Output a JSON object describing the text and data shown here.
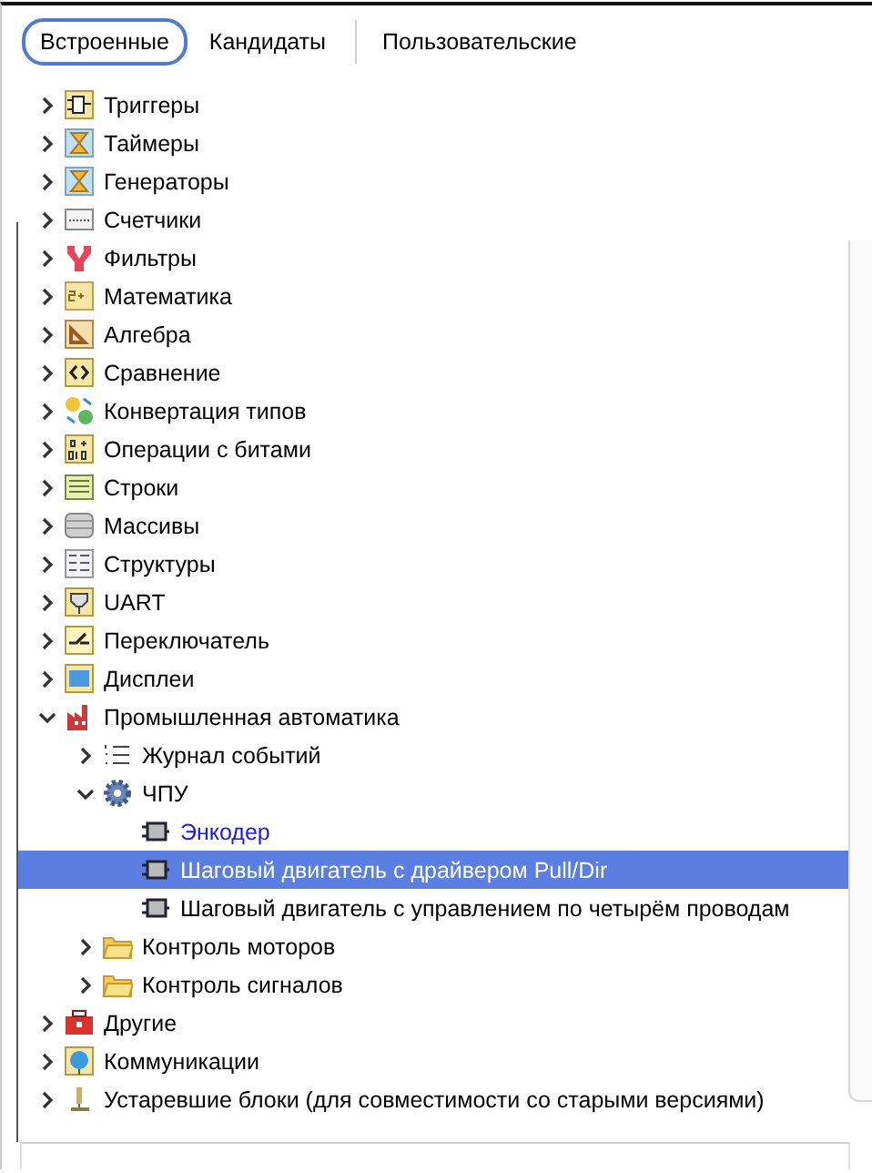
{
  "tabs": [
    {
      "label": "Встроенные",
      "selected": true
    },
    {
      "label": "Кандидаты",
      "selected": false
    },
    {
      "label": "Пользовательские",
      "selected": false
    }
  ],
  "tree": [
    {
      "label": "Триггеры",
      "kind": "flipflop",
      "expanded": false,
      "selected": false
    },
    {
      "label": "Таймеры",
      "kind": "hourglass",
      "expanded": false,
      "selected": false
    },
    {
      "label": "Генераторы",
      "kind": "hourglass",
      "expanded": false,
      "selected": false
    },
    {
      "label": "Счетчики",
      "kind": "counter",
      "expanded": false,
      "selected": false
    },
    {
      "label": "Фильтры",
      "kind": "filter",
      "expanded": false,
      "selected": false
    },
    {
      "label": "Математика",
      "kind": "math",
      "expanded": false,
      "selected": false
    },
    {
      "label": "Алгебра",
      "kind": "ruler",
      "expanded": false,
      "selected": false
    },
    {
      "label": "Сравнение",
      "kind": "compare",
      "expanded": false,
      "selected": false
    },
    {
      "label": "Конвертация типов",
      "kind": "convert",
      "expanded": false,
      "selected": false
    },
    {
      "label": "Операции с битами",
      "kind": "bits",
      "expanded": false,
      "selected": false
    },
    {
      "label": "Строки",
      "kind": "lines",
      "expanded": false,
      "selected": false
    },
    {
      "label": "Массивы",
      "kind": "database",
      "expanded": false,
      "selected": false
    },
    {
      "label": "Структуры",
      "kind": "form",
      "expanded": false,
      "selected": false
    },
    {
      "label": "UART",
      "kind": "plug",
      "expanded": false,
      "selected": false
    },
    {
      "label": "Переключатель",
      "kind": "switch",
      "expanded": false,
      "selected": false
    },
    {
      "label": "Дисплеи",
      "kind": "display",
      "expanded": false,
      "selected": false
    },
    {
      "label": "Промышленная автоматика",
      "kind": "factory",
      "expanded": true,
      "selected": false,
      "children": [
        {
          "label": "Журнал событий",
          "kind": "list",
          "expanded": false,
          "selected": false
        },
        {
          "label": "ЧПУ",
          "kind": "gear",
          "expanded": true,
          "selected": false,
          "children": [
            {
              "label": "Энкодер",
              "kind": "block",
              "selected": false,
              "hovered": true
            },
            {
              "label": "Шаговый двигатель с драйвером Pull/Dir",
              "kind": "block",
              "selected": true,
              "hovered": false
            },
            {
              "label": "Шаговый двигатель с управлением по четырём проводам",
              "kind": "block",
              "selected": false,
              "hovered": false
            }
          ]
        },
        {
          "label": "Контроль моторов",
          "kind": "folder",
          "expanded": false,
          "selected": false
        },
        {
          "label": "Контроль сигналов",
          "kind": "folder",
          "expanded": false,
          "selected": false
        }
      ]
    },
    {
      "label": "Другие",
      "kind": "toolbox",
      "expanded": false,
      "selected": false
    },
    {
      "label": "Коммуникации",
      "kind": "globe",
      "expanded": false,
      "selected": false
    },
    {
      "label": "Устаревшие блоки (для совместимости со старыми версиями)",
      "kind": "microscope",
      "expanded": false,
      "selected": false
    }
  ]
}
